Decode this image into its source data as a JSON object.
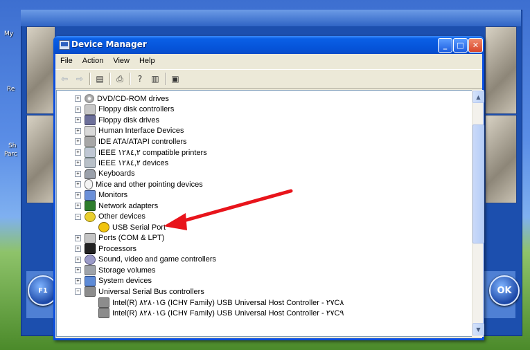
{
  "desktop": {
    "icons": [
      "My",
      "Re",
      "Sh",
      "Parc"
    ]
  },
  "app_buttons": {
    "left_label": "F1",
    "right_label": "OK"
  },
  "window": {
    "title": "Device Manager",
    "buttons": {
      "minimize": "_",
      "maximize": "□",
      "close": "✕"
    }
  },
  "menu": [
    "File",
    "Action",
    "View",
    "Help"
  ],
  "toolbar_icons": [
    "back-icon",
    "forward-icon",
    "properties-icon",
    "print-icon",
    "help-icon",
    "show-hide-icon",
    "scan-hardware-icon"
  ],
  "tree": {
    "items": [
      {
        "label": "DVD/CD-ROM drives",
        "expander": "+",
        "level": 0,
        "icon": "dvd-icon"
      },
      {
        "label": "Floppy disk controllers",
        "expander": "+",
        "level": 0,
        "icon": "floppy-controller-icon"
      },
      {
        "label": "Floppy disk drives",
        "expander": "+",
        "level": 0,
        "icon": "floppy-drive-icon"
      },
      {
        "label": "Human Interface Devices",
        "expander": "+",
        "level": 0,
        "icon": "hid-icon"
      },
      {
        "label": "IDE ATA/ATAPI controllers",
        "expander": "+",
        "level": 0,
        "icon": "ide-icon"
      },
      {
        "label": "IEEE ١٢٨٤,٢ compatible printers",
        "expander": "+",
        "level": 0,
        "icon": "printer-icon"
      },
      {
        "label": "IEEE ١٢٨٤,٢ devices",
        "expander": "+",
        "level": 0,
        "icon": "ieee-device-icon"
      },
      {
        "label": "Keyboards",
        "expander": "+",
        "level": 0,
        "icon": "keyboard-icon"
      },
      {
        "label": "Mice and other pointing devices",
        "expander": "+",
        "level": 0,
        "icon": "mouse-icon"
      },
      {
        "label": "Monitors",
        "expander": "+",
        "level": 0,
        "icon": "monitor-icon"
      },
      {
        "label": "Network adapters",
        "expander": "+",
        "level": 0,
        "icon": "network-adapter-icon"
      },
      {
        "label": "Other devices",
        "expander": "−",
        "level": 0,
        "icon": "other-devices-icon"
      },
      {
        "label": "USB Serial Port",
        "expander": "",
        "level": 1,
        "icon": "warning-device-icon"
      },
      {
        "label": "Ports (COM & LPT)",
        "expander": "+",
        "level": 0,
        "icon": "port-icon"
      },
      {
        "label": "Processors",
        "expander": "+",
        "level": 0,
        "icon": "processor-icon"
      },
      {
        "label": "Sound, video and game controllers",
        "expander": "+",
        "level": 0,
        "icon": "sound-icon"
      },
      {
        "label": "Storage volumes",
        "expander": "+",
        "level": 0,
        "icon": "storage-icon"
      },
      {
        "label": "System devices",
        "expander": "+",
        "level": 0,
        "icon": "system-icon"
      },
      {
        "label": "Universal Serial Bus controllers",
        "expander": "−",
        "level": 0,
        "icon": "usb-icon"
      },
      {
        "label": "Intel(R) ٨٢٨٠١G (ICH٧ Family) USB Universal Host Controller - ٢٧C٨",
        "expander": "",
        "level": 1,
        "icon": "usb-controller-icon"
      },
      {
        "label": "Intel(R) ٨٢٨٠١G (ICH٧ Family) USB Universal Host Controller - ٢٧C٩",
        "expander": "",
        "level": 1,
        "icon": "usb-controller-icon"
      }
    ]
  },
  "scrollbar": {
    "up": "▲",
    "down": "▼"
  },
  "colors": {
    "title_bar": "#0553d8",
    "annotation_arrow": "#e8141b",
    "warning": "#f1c40f"
  }
}
